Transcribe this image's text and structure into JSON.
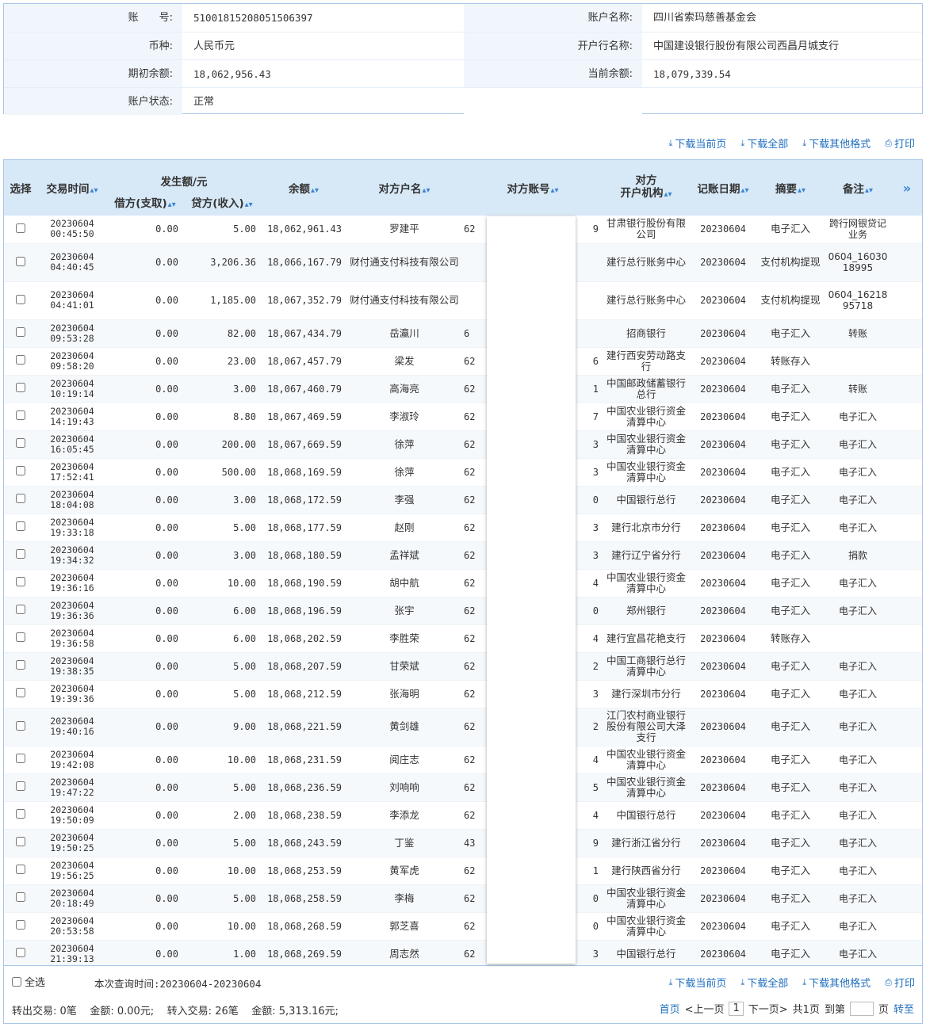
{
  "account": {
    "number_label": "账　　号:",
    "number": "51001815208051506397",
    "name_label": "账户名称:",
    "name": "四川省索玛慈善基金会",
    "currency_label": "币种:",
    "currency": "人民币元",
    "bank_label": "开户行名称:",
    "bank": "中国建设银行股份有限公司西昌月城支行",
    "opening_label": "期初余额:",
    "opening": "18,062,956.43",
    "current_label": "当前余额:",
    "current": "18,079,339.54",
    "status_label": "账户状态:",
    "status": "正常"
  },
  "actions": {
    "download_page": "下载当前页",
    "download_all": "下载全部",
    "download_other": "下载其他格式",
    "print": "打印"
  },
  "table": {
    "headers": {
      "select": "选择",
      "time": "交易时间",
      "amount_group": "发生额/元",
      "debit": "借方(支取)",
      "credit": "贷方(收入)",
      "balance": "余额",
      "party_name": "对方户名",
      "party_account": "对方账号",
      "party_bank": "对方\n开户机构",
      "post_date": "记账日期",
      "summary": "摘要",
      "remark": "备注",
      "more": "»"
    },
    "rows": [
      {
        "date": "20230604",
        "time": "00:45:50",
        "debit": "0.00",
        "credit": "5.00",
        "balance": "18,062,961.43",
        "name": "罗建平",
        "acc_l": "62",
        "acc_r": "9",
        "bank": "甘肃银行股份有限公司",
        "post": "20230604",
        "summary": "电子汇入",
        "remark": "跨行网银贷记业务"
      },
      {
        "date": "20230604",
        "time": "04:40:45",
        "debit": "0.00",
        "credit": "3,206.36",
        "balance": "18,066,167.79",
        "name": "财付通支付科技有限公司",
        "acc_l": "",
        "acc_r": "",
        "bank": "建行总行账务中心",
        "post": "20230604",
        "summary": "支付机构提现",
        "remark": "0604_1603018995"
      },
      {
        "date": "20230604",
        "time": "04:41:01",
        "debit": "0.00",
        "credit": "1,185.00",
        "balance": "18,067,352.79",
        "name": "财付通支付科技有限公司",
        "acc_l": "",
        "acc_r": "",
        "bank": "建行总行账务中心",
        "post": "20230604",
        "summary": "支付机构提现",
        "remark": "0604_1621895718"
      },
      {
        "date": "20230604",
        "time": "09:53:28",
        "debit": "0.00",
        "credit": "82.00",
        "balance": "18,067,434.79",
        "name": "岳瀛川",
        "acc_l": "6",
        "acc_r": "",
        "bank": "招商银行",
        "post": "20230604",
        "summary": "电子汇入",
        "remark": "转账"
      },
      {
        "date": "20230604",
        "time": "09:58:20",
        "debit": "0.00",
        "credit": "23.00",
        "balance": "18,067,457.79",
        "name": "梁发",
        "acc_l": "62",
        "acc_r": "6",
        "bank": "建行西安劳动路支行",
        "post": "20230604",
        "summary": "转账存入",
        "remark": ""
      },
      {
        "date": "20230604",
        "time": "10:19:14",
        "debit": "0.00",
        "credit": "3.00",
        "balance": "18,067,460.79",
        "name": "高海亮",
        "acc_l": "62",
        "acc_r": "1",
        "bank": "中国邮政储蓄银行总行",
        "post": "20230604",
        "summary": "电子汇入",
        "remark": "转账"
      },
      {
        "date": "20230604",
        "time": "14:19:43",
        "debit": "0.00",
        "credit": "8.80",
        "balance": "18,067,469.59",
        "name": "李淑玲",
        "acc_l": "62",
        "acc_r": "7",
        "bank": "中国农业银行资金清算中心",
        "post": "20230604",
        "summary": "电子汇入",
        "remark": "电子汇入"
      },
      {
        "date": "20230604",
        "time": "16:05:45",
        "debit": "0.00",
        "credit": "200.00",
        "balance": "18,067,669.59",
        "name": "徐萍",
        "acc_l": "62",
        "acc_r": "3",
        "bank": "中国农业银行资金清算中心",
        "post": "20230604",
        "summary": "电子汇入",
        "remark": "电子汇入"
      },
      {
        "date": "20230604",
        "time": "17:52:41",
        "debit": "0.00",
        "credit": "500.00",
        "balance": "18,068,169.59",
        "name": "徐萍",
        "acc_l": "62",
        "acc_r": "3",
        "bank": "中国农业银行资金清算中心",
        "post": "20230604",
        "summary": "电子汇入",
        "remark": "电子汇入"
      },
      {
        "date": "20230604",
        "time": "18:04:08",
        "debit": "0.00",
        "credit": "3.00",
        "balance": "18,068,172.59",
        "name": "李强",
        "acc_l": "62",
        "acc_r": "0",
        "bank": "中国银行总行",
        "post": "20230604",
        "summary": "电子汇入",
        "remark": "电子汇入"
      },
      {
        "date": "20230604",
        "time": "19:33:18",
        "debit": "0.00",
        "credit": "5.00",
        "balance": "18,068,177.59",
        "name": "赵刚",
        "acc_l": "62",
        "acc_r": "3",
        "bank": "建行北京市分行",
        "post": "20230604",
        "summary": "电子汇入",
        "remark": "电子汇入"
      },
      {
        "date": "20230604",
        "time": "19:34:32",
        "debit": "0.00",
        "credit": "3.00",
        "balance": "18,068,180.59",
        "name": "孟祥斌",
        "acc_l": "62",
        "acc_r": "3",
        "bank": "建行辽宁省分行",
        "post": "20230604",
        "summary": "电子汇入",
        "remark": "捐款"
      },
      {
        "date": "20230604",
        "time": "19:36:16",
        "debit": "0.00",
        "credit": "10.00",
        "balance": "18,068,190.59",
        "name": "胡中航",
        "acc_l": "62",
        "acc_r": "4",
        "bank": "中国农业银行资金清算中心",
        "post": "20230604",
        "summary": "电子汇入",
        "remark": "电子汇入"
      },
      {
        "date": "20230604",
        "time": "19:36:36",
        "debit": "0.00",
        "credit": "6.00",
        "balance": "18,068,196.59",
        "name": "张宇",
        "acc_l": "62",
        "acc_r": "0",
        "bank": "郑州银行",
        "post": "20230604",
        "summary": "电子汇入",
        "remark": "电子汇入"
      },
      {
        "date": "20230604",
        "time": "19:36:58",
        "debit": "0.00",
        "credit": "6.00",
        "balance": "18,068,202.59",
        "name": "李胜荣",
        "acc_l": "62",
        "acc_r": "4",
        "bank": "建行宜昌花艳支行",
        "post": "20230604",
        "summary": "转账存入",
        "remark": ""
      },
      {
        "date": "20230604",
        "time": "19:38:35",
        "debit": "0.00",
        "credit": "5.00",
        "balance": "18,068,207.59",
        "name": "甘荣斌",
        "acc_l": "62",
        "acc_r": "2",
        "bank": "中国工商银行总行清算中心",
        "post": "20230604",
        "summary": "电子汇入",
        "remark": "电子汇入"
      },
      {
        "date": "20230604",
        "time": "19:39:36",
        "debit": "0.00",
        "credit": "5.00",
        "balance": "18,068,212.59",
        "name": "张海明",
        "acc_l": "62",
        "acc_r": "3",
        "bank": "建行深圳市分行",
        "post": "20230604",
        "summary": "电子汇入",
        "remark": "电子汇入"
      },
      {
        "date": "20230604",
        "time": "19:40:16",
        "debit": "0.00",
        "credit": "9.00",
        "balance": "18,068,221.59",
        "name": "黄剑雄",
        "acc_l": "62",
        "acc_r": "2",
        "bank": "江门农村商业银行股份有限公司大泽支行",
        "post": "20230604",
        "summary": "电子汇入",
        "remark": "电子汇入"
      },
      {
        "date": "20230604",
        "time": "19:42:08",
        "debit": "0.00",
        "credit": "10.00",
        "balance": "18,068,231.59",
        "name": "阅庄志",
        "acc_l": "62",
        "acc_r": "4",
        "bank": "中国农业银行资金清算中心",
        "post": "20230604",
        "summary": "电子汇入",
        "remark": "电子汇入"
      },
      {
        "date": "20230604",
        "time": "19:47:22",
        "debit": "0.00",
        "credit": "5.00",
        "balance": "18,068,236.59",
        "name": "刘响响",
        "acc_l": "62",
        "acc_r": "5",
        "bank": "中国农业银行资金清算中心",
        "post": "20230604",
        "summary": "电子汇入",
        "remark": "电子汇入"
      },
      {
        "date": "20230604",
        "time": "19:50:09",
        "debit": "0.00",
        "credit": "2.00",
        "balance": "18,068,238.59",
        "name": "李添龙",
        "acc_l": "62",
        "acc_r": "4",
        "bank": "中国银行总行",
        "post": "20230604",
        "summary": "电子汇入",
        "remark": "电子汇入"
      },
      {
        "date": "20230604",
        "time": "19:50:25",
        "debit": "0.00",
        "credit": "5.00",
        "balance": "18,068,243.59",
        "name": "丁鉴",
        "acc_l": "43",
        "acc_r": "9",
        "bank": "建行浙江省分行",
        "post": "20230604",
        "summary": "电子汇入",
        "remark": "电子汇入"
      },
      {
        "date": "20230604",
        "time": "19:56:25",
        "debit": "0.00",
        "credit": "10.00",
        "balance": "18,068,253.59",
        "name": "黄军虎",
        "acc_l": "62",
        "acc_r": "1",
        "bank": "建行陕西省分行",
        "post": "20230604",
        "summary": "电子汇入",
        "remark": "电子汇入"
      },
      {
        "date": "20230604",
        "time": "20:18:49",
        "debit": "0.00",
        "credit": "5.00",
        "balance": "18,068,258.59",
        "name": "李梅",
        "acc_l": "62",
        "acc_r": "0",
        "bank": "中国农业银行资金清算中心",
        "post": "20230604",
        "summary": "电子汇入",
        "remark": "电子汇入"
      },
      {
        "date": "20230604",
        "time": "20:53:58",
        "debit": "0.00",
        "credit": "10.00",
        "balance": "18,068,268.59",
        "name": "郭芝喜",
        "acc_l": "62",
        "acc_r": "0",
        "bank": "中国农业银行资金清算中心",
        "post": "20230604",
        "summary": "电子汇入",
        "remark": "电子汇入"
      },
      {
        "date": "20230604",
        "time": "21:39:13",
        "debit": "0.00",
        "credit": "1.00",
        "balance": "18,068,269.59",
        "name": "周志然",
        "acc_l": "62",
        "acc_r": "3",
        "bank": "中国银行总行",
        "post": "20230604",
        "summary": "电子汇入",
        "remark": "电子汇入"
      }
    ]
  },
  "footer": {
    "select_all": "全选",
    "query_time": "本次查询时间:20230604-20230604",
    "summary_line": "转出交易: 0笔    金额: 0.00元;    转入交易: 26笔    金额: 5,313.16元;",
    "first": "首页",
    "prev": "<上一页",
    "page": "1",
    "next": "下一页>",
    "total": "共1页",
    "goto_label": "到第",
    "page_unit": "页",
    "go": "转至"
  }
}
